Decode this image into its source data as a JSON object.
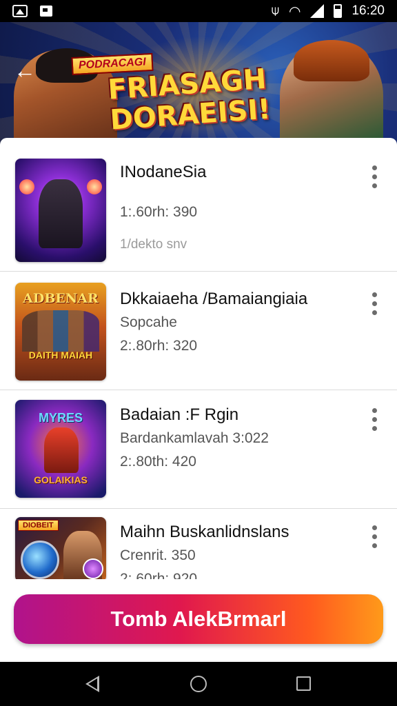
{
  "status_bar": {
    "time": "16:20"
  },
  "banner": {
    "badge": "PODRACAGI",
    "title_line1": "FRIASAGH",
    "title_line2": "DORAEISI!"
  },
  "items": [
    {
      "title": "INodaneSia",
      "line1": "1:.60rh: 390",
      "line2": "1/dekto snv"
    },
    {
      "title": "Dkkaiaeha /Bamaiangiaia",
      "line1": "Sopcahe",
      "line2": "2:.80rh: 320",
      "thumb_top": "ADBENAR",
      "thumb_bottom": "DAITH MAIAH"
    },
    {
      "title": "Badaian :F Rgin",
      "line1": "Bardankamlavah 3:022",
      "line2": "2:.80th: 420",
      "thumb_top": "MYRES",
      "thumb_bottom": "GOLAIKIAS"
    },
    {
      "title": "Maihn Buskanlidnslans",
      "line1": "Crenrit. 350",
      "line2": "2:.60rh: 920",
      "thumb_badge": "DIOBEIT"
    }
  ],
  "cta": {
    "label": "Tomb AlekBrmarl"
  },
  "colors": {
    "cta_start": "#b0138c",
    "cta_end": "#ff9a1a",
    "title": "#111111",
    "subtitle": "#555555"
  }
}
